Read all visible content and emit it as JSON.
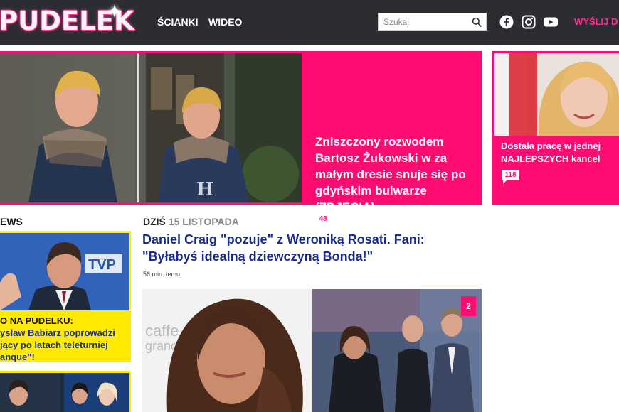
{
  "header": {
    "logo": "PUDELEK",
    "nav": [
      "ŚCIANKI",
      "WIDEO"
    ],
    "search_placeholder": "Szukaj",
    "send_link": "WYŚLIJ D"
  },
  "hero": {
    "title": "Zniszczony rozwodem Bartosz Żukowski w za małym dresie snuje się po gdyńskim bulwarze (ZDJĘCIA)",
    "comments": "48"
  },
  "side_hero": {
    "title_line1": "Dostała pracę w jednej",
    "title_line2": "NAJLEPSZYCH kancel",
    "comments": "118"
  },
  "left": {
    "label": "EWS",
    "card_kicker": "O NA PUDELKU:",
    "card_text": "ysław Babiarz poprowadzi jący po latach teleturniej anque\"!",
    "card_logo": "TVP"
  },
  "main": {
    "today_label": "DZIŚ",
    "today_date": "15 LISTOPADA",
    "article_title": "Daniel Craig \"pozuje\" z Weroniką Rosati. Fani: \"Byłabyś idealną dziewczyną Bonda!\"",
    "time_ago": "56 min. temu",
    "gallery_count": "2",
    "photo_text_1": "caffe",
    "photo_text_2": "grano"
  },
  "colors": {
    "brand_pink": "#ff0c73",
    "header_bg": "#2b2d33",
    "link_blue": "#1a2c8f",
    "yellow": "#ffea00"
  }
}
